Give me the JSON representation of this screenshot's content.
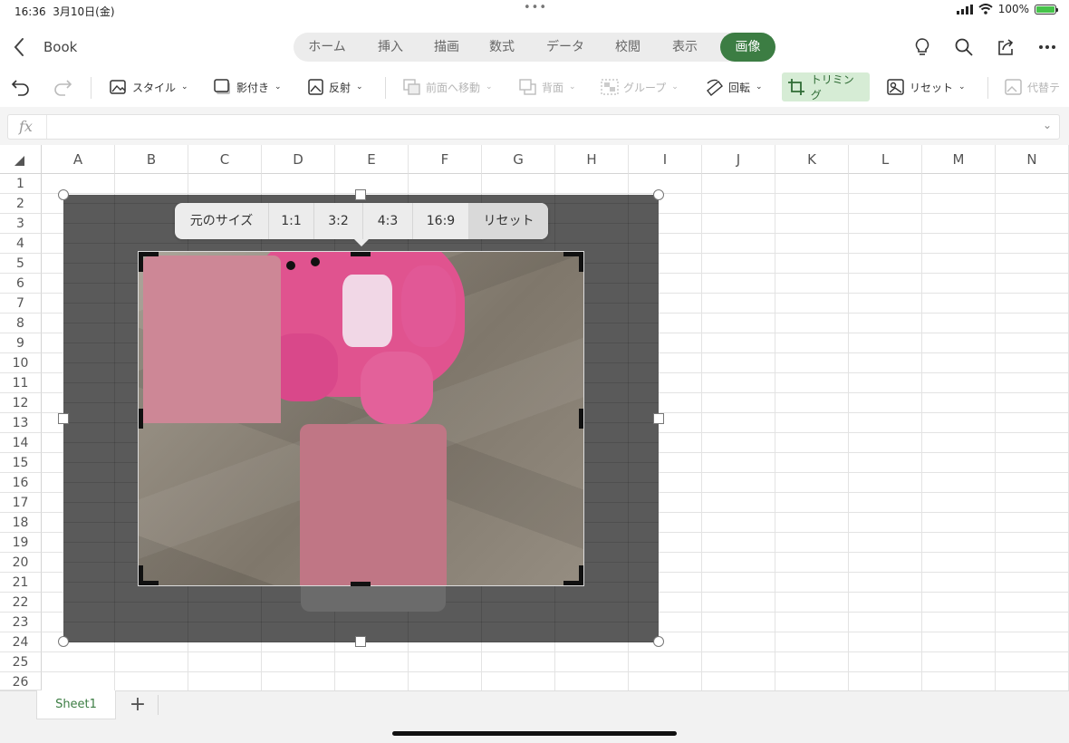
{
  "status": {
    "time": "16:36",
    "date": "3月10日(金)",
    "battery": "100%"
  },
  "document": {
    "name": "Book"
  },
  "tabs": [
    "ホーム",
    "挿入",
    "描画",
    "数式",
    "データ",
    "校閲",
    "表示",
    "画像"
  ],
  "active_tab": "画像",
  "ribbon": {
    "style": "スタイル",
    "shadow": "影付き",
    "reflection": "反射",
    "bring_forward": "前面へ移動",
    "send_back": "背面",
    "group": "グループ",
    "rotate": "回転",
    "crop": "トリミング",
    "reset": "リセット",
    "alt_text": "代替テ"
  },
  "formula": {
    "fx_label": "fx"
  },
  "columns": [
    "A",
    "B",
    "C",
    "D",
    "E",
    "F",
    "G",
    "H",
    "I",
    "J",
    "K",
    "L",
    "M",
    "N"
  ],
  "rows": [
    "1",
    "2",
    "3",
    "4",
    "5",
    "6",
    "7",
    "8",
    "9",
    "10",
    "11",
    "12",
    "13",
    "14",
    "15",
    "16",
    "17",
    "18",
    "19",
    "20",
    "21",
    "22",
    "23",
    "24",
    "25",
    "26"
  ],
  "crop_ratios": [
    "元のサイズ",
    "1:1",
    "3:2",
    "4:3",
    "16:9",
    "リセット"
  ],
  "sheets": {
    "active": "Sheet1",
    "add_label": "+"
  }
}
